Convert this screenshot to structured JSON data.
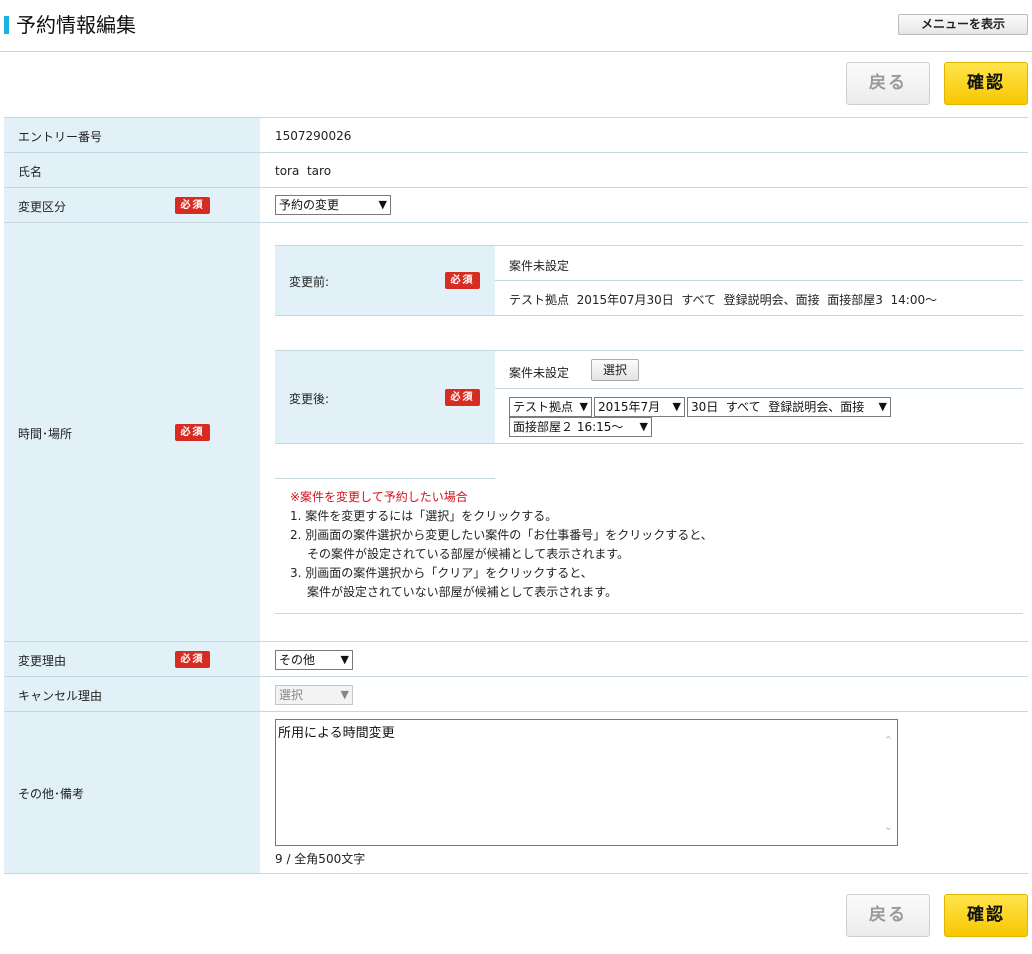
{
  "header": {
    "title": "予約情報編集",
    "menu_button": "メニューを表示"
  },
  "actions": {
    "back_label": "戻る",
    "confirm_label": "確認"
  },
  "required_badge": "必須",
  "fields": {
    "entry_number": {
      "label": "エントリー番号",
      "value": "1507290026"
    },
    "name": {
      "label": "氏名",
      "value": "tora  taro"
    },
    "change_type": {
      "label": "変更区分",
      "selected": "予約の変更"
    },
    "time_place": {
      "label": "時間･場所",
      "before_label": "変更前:",
      "before_status": "案件未設定",
      "before_detail": "テスト拠点  2015年07月30日  すべて  登録説明会、面接  面接部屋3  14:00～",
      "after_label": "変更後:",
      "after_status": "案件未設定",
      "select_button": "選択",
      "after_selects": {
        "location": "テスト拠点",
        "month": "2015年7月",
        "day": "30日  すべて  登録説明会、面接",
        "room": "面接部屋２ 16:15～"
      }
    },
    "change_reason": {
      "label": "変更理由",
      "selected": "その他"
    },
    "cancel_reason": {
      "label": "キャンセル理由",
      "selected": "選択"
    },
    "remarks": {
      "label": "その他･備考",
      "value": "所用による時間変更",
      "counter": "9 / 全角500文字"
    }
  },
  "notes": {
    "heading": "※案件を変更して予約したい場合",
    "line1": "1. 案件を変更するには「選択」をクリックする。",
    "line2a": "2. 別画面の案件選択から変更したい案件の「お仕事番号」をクリックすると、",
    "line2b": "その案件が設定されている部屋が候補として表示されます。",
    "line3a": "3. 別画面の案件選択から「クリア」をクリックすると、",
    "line3b": "案件が設定されていない部屋が候補として表示されます。"
  },
  "colors": {
    "accent_bar": "#19b3e0",
    "label_bg": "#e2f1f8",
    "required_badge": "#d62c21",
    "confirm_button": "#f7c800",
    "warning_text": "#d0121b"
  }
}
